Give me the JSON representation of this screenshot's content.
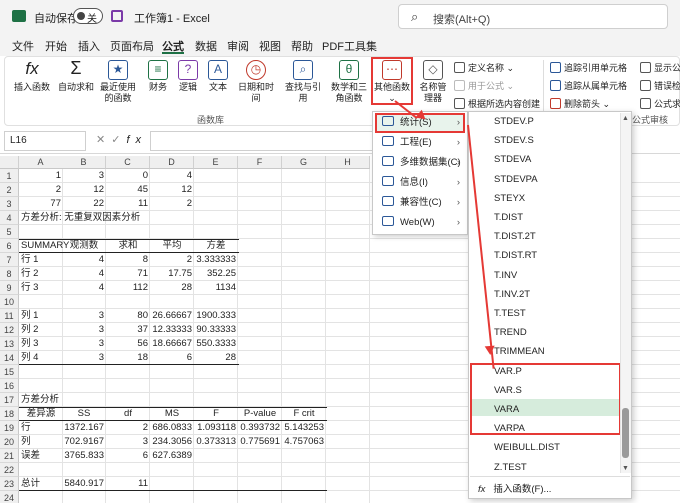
{
  "titlebar": {
    "autosave": "自动保存",
    "toggle": "关",
    "title": "工作簿1 - Excel",
    "search": "搜索(Alt+Q)"
  },
  "menubar": [
    "文件",
    "开始",
    "插入",
    "页面布局",
    "公式",
    "数据",
    "审阅",
    "视图",
    "帮助",
    "PDF工具集"
  ],
  "ribbon": {
    "insert_fn": "插入函数",
    "autosum": "自动求和",
    "recent": "最近使用的函数",
    "financial": "财务",
    "logical": "逻辑",
    "text": "文本",
    "datetime": "日期和时间",
    "lookup": "查找与引用",
    "math": "数学和三角函数",
    "other": "其他函数",
    "name_mgr": "名称管理器",
    "define_name": "定义名称",
    "use_in_formula": "用于公式",
    "create_from_sel": "根据所选内容创建",
    "trace_prec": "追踪引用单元格",
    "trace_dep": "追踪从属单元格",
    "remove_arrows": "删除箭头",
    "show_formulas": "显示公式",
    "error_check": "错误检查",
    "eval_formula": "公式求值",
    "audit_group": "公式审核",
    "group": "函数库"
  },
  "formulabar": {
    "namebox": "L16",
    "fx": "fx"
  },
  "columns": [
    "A",
    "B",
    "C",
    "D",
    "E",
    "F",
    "G",
    "H"
  ],
  "rows": [
    "1",
    "2",
    "3",
    "4",
    "5",
    "6",
    "7",
    "8",
    "9",
    "10",
    "11",
    "12",
    "13",
    "14",
    "15",
    "16",
    "17",
    "18",
    "19",
    "20",
    "21",
    "22",
    "23",
    "24",
    "25"
  ],
  "cells": {
    "r1": [
      "1",
      "3",
      "0",
      "4"
    ],
    "r2": [
      "2",
      "12",
      "45",
      "12"
    ],
    "r3": [
      "77",
      "22",
      "11",
      "2"
    ],
    "r4": "方差分析: 无重复双因素分析",
    "r6": [
      "SUMMARY",
      "观测数",
      "求和",
      "平均",
      "方差"
    ],
    "r7": [
      "行 1",
      "4",
      "8",
      "2",
      "3.333333"
    ],
    "r8": [
      "行 2",
      "4",
      "71",
      "17.75",
      "352.25"
    ],
    "r9": [
      "行 3",
      "4",
      "112",
      "28",
      "1134"
    ],
    "r11": [
      "列 1",
      "3",
      "80",
      "26.66667",
      "1900.333"
    ],
    "r12": [
      "列 2",
      "3",
      "37",
      "12.33333",
      "90.33333"
    ],
    "r13": [
      "列 3",
      "3",
      "56",
      "18.66667",
      "550.3333"
    ],
    "r14": [
      "列 4",
      "3",
      "18",
      "6",
      "28"
    ],
    "r17": "方差分析",
    "r18": [
      "差异源",
      "SS",
      "df",
      "MS",
      "F",
      "P-value",
      "F crit"
    ],
    "r19": [
      "行",
      "1372.167",
      "2",
      "686.0833",
      "1.093118",
      "0.393732",
      "5.143253"
    ],
    "r20": [
      "列",
      "702.9167",
      "3",
      "234.3056",
      "0.373313",
      "0.775691",
      "4.757063"
    ],
    "r21": [
      "误差",
      "3765.833",
      "6",
      "627.6389"
    ],
    "r23": [
      "总计",
      "5840.917",
      "11"
    ]
  },
  "menu1": [
    {
      "label": "统计(S)"
    },
    {
      "label": "工程(E)"
    },
    {
      "label": "多维数据集(C)"
    },
    {
      "label": "信息(I)"
    },
    {
      "label": "兼容性(C)"
    },
    {
      "label": "Web(W)"
    }
  ],
  "menu2": [
    "STDEV.P",
    "STDEV.S",
    "STDEVA",
    "STDEVPA",
    "STEYX",
    "T.DIST",
    "T.DIST.2T",
    "T.DIST.RT",
    "T.INV",
    "T.INV.2T",
    "T.TEST",
    "TREND",
    "TRIMMEAN",
    "VAR.P",
    "VAR.S",
    "VARA",
    "VARPA",
    "WEIBULL.DIST",
    "Z.TEST"
  ],
  "menu2_insert": "插入函数(F)..."
}
